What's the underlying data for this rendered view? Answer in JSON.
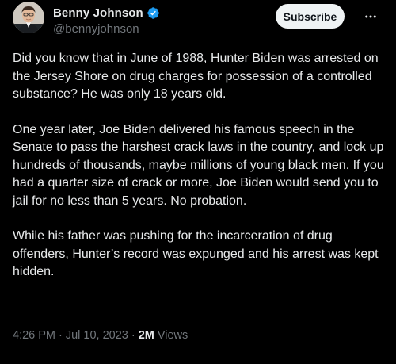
{
  "author": {
    "display_name": "Benny Johnson",
    "handle": "@bennyjohnson",
    "verified": true
  },
  "actions": {
    "subscribe_label": "Subscribe",
    "more_icon": "more-horizontal-icon"
  },
  "tweet": {
    "paragraphs": [
      "Did you know that in June of 1988, Hunter Biden was arrested on the Jersey Shore on drug charges for possession of a controlled substance? He was only 18 years old.",
      "One year later, Joe Biden delivered his famous speech in the Senate to pass the harshest crack laws in the country, and lock up hundreds of thousands, maybe millions of young black men. If you had a quarter size of crack or more, Joe Biden would send you to jail for no less than 5 years. No probation.",
      "While his father was pushing for the incarceration of drug offenders, Hunter’s record was expunged and his arrest was kept hidden."
    ]
  },
  "meta": {
    "time": "4:26 PM",
    "separator1": "·",
    "date": "Jul 10, 2023",
    "separator2": "·",
    "views_count": "2M",
    "views_label": "Views"
  },
  "colors": {
    "background": "#000000",
    "text": "#e7e9ea",
    "secondary_text": "#71767b",
    "verified_badge": "#1d9bf0",
    "subscribe_bg": "#eff3f4"
  }
}
